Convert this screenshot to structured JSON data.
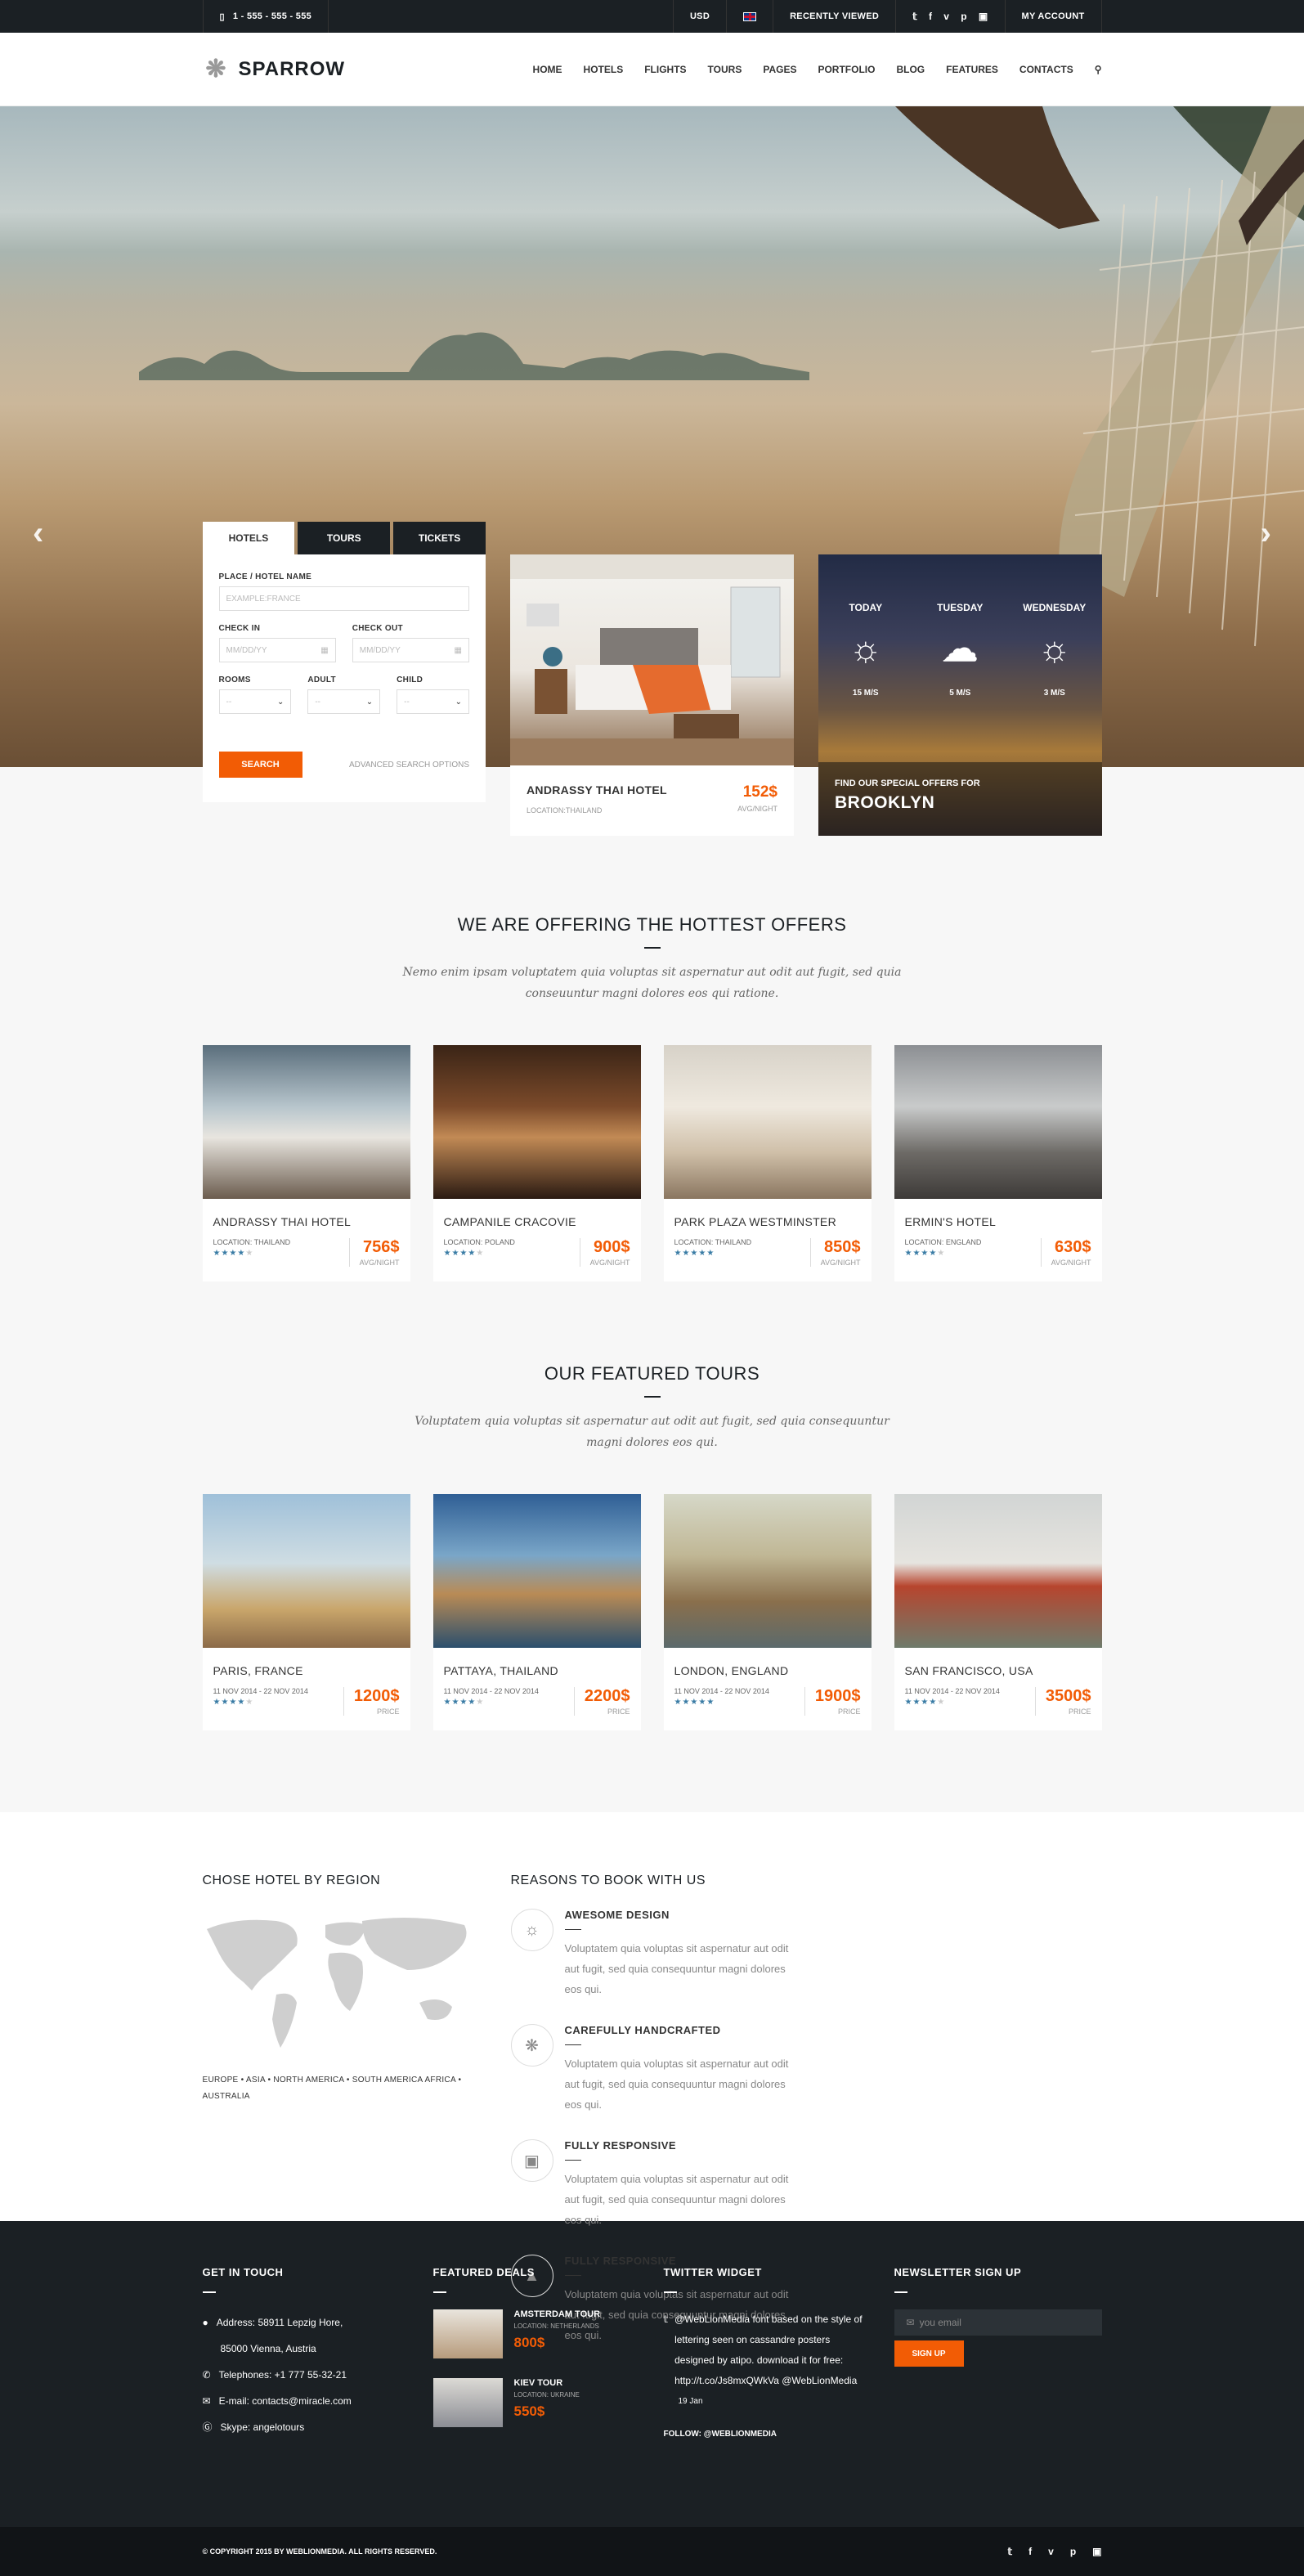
{
  "topbar": {
    "phone": "1 - 555 - 555 - 555",
    "currency": "USD",
    "recent": "RECENTLY VIEWED",
    "social": [
      "t",
      "f",
      "v",
      "p",
      "ig"
    ],
    "account": "MY ACCOUNT"
  },
  "nav": {
    "logo": "SPARROW",
    "items": [
      "HOME",
      "HOTELS",
      "FLIGHTS",
      "TOURS",
      "PAGES",
      "PORTFOLIO",
      "BLOG",
      "FEATURES",
      "CONTACTS"
    ]
  },
  "search": {
    "tabs": [
      "HOTELS",
      "TOURS",
      "TICKETS"
    ],
    "place_label": "PLACE / HOTEL NAME",
    "place_placeholder": "EXAMPLE:FRANCE",
    "checkin_label": "CHECK IN",
    "checkout_label": "CHECK OUT",
    "date_placeholder": "MM/DD/YY",
    "rooms_label": "ROOMS",
    "adult_label": "ADULT",
    "child_label": "CHILD",
    "select_value": "--",
    "button": "SEARCH",
    "advanced": "ADVANCED SEARCH OPTIONS"
  },
  "featured_hotel": {
    "name": "ANDRASSY THAI HOTEL",
    "location": "LOCATION:THAILAND",
    "price": "152$",
    "unit": "AVG/NIGHT"
  },
  "weather": {
    "days": [
      {
        "day": "TODAY",
        "icon": "sun-icon",
        "wind": "15 M/S"
      },
      {
        "day": "TUESDAY",
        "icon": "cloud-icon",
        "wind": "5 M/S"
      },
      {
        "day": "WEDNESDAY",
        "icon": "sun-icon",
        "wind": "3 M/S"
      }
    ],
    "sub": "FIND OUR SPECIAL OFFERS FOR",
    "city": "BROOKLYN"
  },
  "offers": {
    "title": "WE ARE OFFERING THE HOTTEST OFFERS",
    "text": "Nemo enim ipsam voluptatem quia voluptas sit aspernatur aut odit aut fugit, sed quia conseuuntur magni dolores eos qui ratione.",
    "items": [
      {
        "name": "ANDRASSY THAI HOTEL",
        "location": "LOCATION: THAILAND",
        "price": "756$",
        "unit": "AVG/NIGHT",
        "stars": 4
      },
      {
        "name": "CAMPANILE CRACOVIE",
        "location": "LOCATION: POLAND",
        "price": "900$",
        "unit": "AVG/NIGHT",
        "stars": 4
      },
      {
        "name": "PARK PLAZA WESTMINSTER",
        "location": "LOCATION: THAILAND",
        "price": "850$",
        "unit": "AVG/NIGHT",
        "stars": 5
      },
      {
        "name": "ERMIN'S HOTEL",
        "location": "LOCATION: ENGLAND",
        "price": "630$",
        "unit": "AVG/NIGHT",
        "stars": 4
      }
    ]
  },
  "tours": {
    "title": "OUR FEATURED TOURS",
    "text": "Voluptatem quia voluptas sit aspernatur aut odit aut fugit, sed quia consequuntur magni dolores eos qui.",
    "items": [
      {
        "name": "PARIS, FRANCE",
        "dates": "11 NOV 2014 - 22 NOV 2014",
        "price": "1200$",
        "unit": "PRICE",
        "stars": 4
      },
      {
        "name": "PATTAYA, THAILAND",
        "dates": "11 NOV 2014 - 22 NOV 2014",
        "price": "2200$",
        "unit": "PRICE",
        "stars": 4
      },
      {
        "name": "LONDON, ENGLAND",
        "dates": "11 NOV 2014 - 22 NOV 2014",
        "price": "1900$",
        "unit": "PRICE",
        "stars": 5
      },
      {
        "name": "SAN FRANCISCO, USA",
        "dates": "11 NOV 2014 - 22 NOV 2014",
        "price": "3500$",
        "unit": "PRICE",
        "stars": 4
      }
    ]
  },
  "region": {
    "title": "CHOSE HOTEL BY REGION",
    "links": "EUROPE  •  ASIA  •  NORTH AMERICA  •  SOUTH AMERICA  AFRICA  •  AUSTRALIA"
  },
  "reasons": {
    "title": "REASONS TO BOOK WITH US",
    "items": [
      {
        "title": "AWESOME DESIGN",
        "text": "Voluptatem quia voluptas sit aspernatur aut odit aut fugit, sed quia consequuntur magni dolores eos qui.",
        "icon": "lightbulb-icon"
      },
      {
        "title": "CAREFULLY HANDCRAFTED",
        "text": "Voluptatem quia voluptas sit aspernatur aut odit aut fugit, sed quia consequuntur magni dolores eos qui.",
        "icon": "puzzle-icon"
      },
      {
        "title": "FULLY RESPONSIVE",
        "text": "Voluptatem quia voluptas sit aspernatur aut odit aut fugit, sed quia consequuntur magni dolores eos qui.",
        "icon": "devices-icon"
      },
      {
        "title": "FULLY RESPONSIVE",
        "text": "Voluptatem quia voluptas sit aspernatur aut odit aut fugit, sed quia consequuntur magni dolores eos qui.",
        "icon": "compass-icon"
      }
    ]
  },
  "footer": {
    "contact_title": "GET IN TOUCH",
    "address1": "Address: 58911 Lepzig Hore,",
    "address2": "85000 Vienna, Austria",
    "phone": "Telephones: +1 777 55-32-21",
    "email": "E-mail: contacts@miracle.com",
    "skype": "Skype: angelotours",
    "deals_title": "FEATURED DEALS",
    "deals": [
      {
        "name": "AMSTERDAM TOUR",
        "location": "LOCATION: NETHERLANDS",
        "price": "800$"
      },
      {
        "name": "KIEV TOUR",
        "location": "LOCATION: UKRAINE",
        "price": "550$"
      }
    ],
    "twitter_title": "TWITTER WIDGET",
    "tweet": "@WebLionMedia font based on the style of lettering seen on cassandre posters designed by atipo. download it for free: http://t.co/Js8mxQWkVa @WebLionMedia",
    "tweet_date": "19 Jan",
    "follow": "FOLLOW: @WEBLIONMEDIA",
    "newsletter_title": "NEWSLETTER SIGN UP",
    "email_placeholder": "you email",
    "signup": "SIGN UP",
    "copyright": "© COPYRIGHT 2015 BY WEBLIONMEDIA. ALL RIGHTS RESERVED."
  }
}
